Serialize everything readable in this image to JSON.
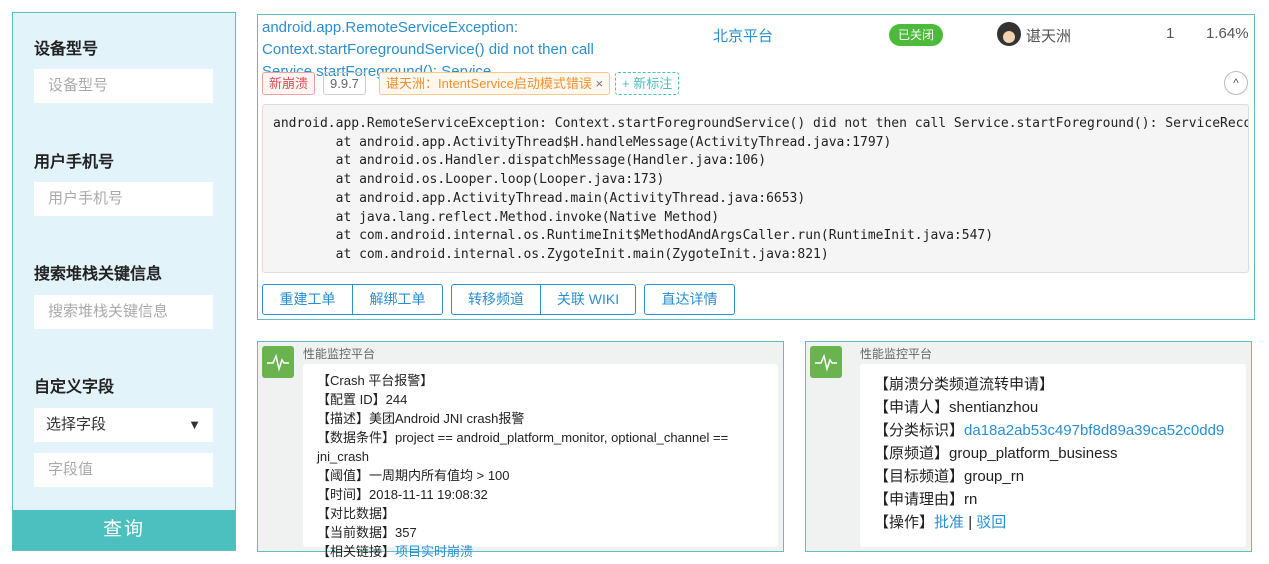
{
  "filters": {
    "device_model": {
      "label": "设备型号",
      "placeholder": "设备型号"
    },
    "phone": {
      "label": "用户手机号",
      "placeholder": "用户手机号"
    },
    "stack_search": {
      "label": "搜索堆栈关键信息",
      "placeholder": "搜索堆栈关键信息"
    },
    "custom_field": {
      "label": "自定义字段",
      "select_value": "选择字段",
      "value_placeholder": "字段值"
    },
    "query_button": "查询"
  },
  "crash": {
    "title": "android.app.RemoteServiceException: Context.startForegroundService() did not then call Service.startForeground(): Service...",
    "platform": "北京平台",
    "status": "已关闭",
    "user": "谌天洲",
    "count": "1",
    "percent": "1.64%",
    "tags": {
      "new": "新崩溃",
      "version": "9.9.7",
      "label": "谌天洲：IntentService启动模式错误",
      "add": "+ 新标注",
      "remove": "×"
    },
    "stack": "android.app.RemoteServiceException: Context.startForegroundService() did not then call Service.startForeground(): ServiceRecord\n        at android.app.ActivityThread$H.handleMessage(ActivityThread.java:1797)\n        at android.os.Handler.dispatchMessage(Handler.java:106)\n        at android.os.Looper.loop(Looper.java:173)\n        at android.app.ActivityThread.main(ActivityThread.java:6653)\n        at java.lang.reflect.Method.invoke(Native Method)\n        at com.android.internal.os.RuntimeInit$MethodAndArgsCaller.run(RuntimeInit.java:547)\n        at com.android.internal.os.ZygoteInit.main(ZygoteInit.java:821)",
    "buttons": {
      "rebuild": "重建工单",
      "unbind": "解绑工单",
      "transfer": "转移频道",
      "wiki": "关联 WIKI",
      "detail": "直达详情"
    },
    "collapse_icon": "chevron-up-icon"
  },
  "alert_message": {
    "source": "性能监控平台",
    "lines": [
      "【Crash 平台报警】",
      "【配置 ID】244",
      "【描述】美团Android JNI crash报警",
      "【数据条件】project == android_platform_monitor, optional_channel == jni_crash",
      "【阈值】一周期内所有值均 > 100",
      "【时间】2018-11-11 19:08:32",
      "【对比数据】",
      "【当前数据】357"
    ],
    "link_label": "【相关链接】",
    "link_text": "项目实时崩溃"
  },
  "transfer_message": {
    "source": "性能监控平台",
    "title": "【崩溃分类频道流转申请】",
    "applicant_label": "【申请人】",
    "applicant": "shentianzhou",
    "id_label": "【分类标识】",
    "id": "da18a2ab53c497bf8d89a39ca52c0dd9",
    "from_label": "【原频道】",
    "from": "group_platform_business",
    "to_label": "【目标频道】",
    "to": "group_rn",
    "reason_label": "【申请理由】",
    "reason": "rn",
    "action_label": "【操作】",
    "approve": "批准",
    "sep": " | ",
    "reject": "驳回"
  },
  "colors": {
    "accent": "#2a8fd0",
    "teal": "#4cbfbf",
    "status_green": "#4cba3a",
    "icon_green": "#6bb34f"
  }
}
